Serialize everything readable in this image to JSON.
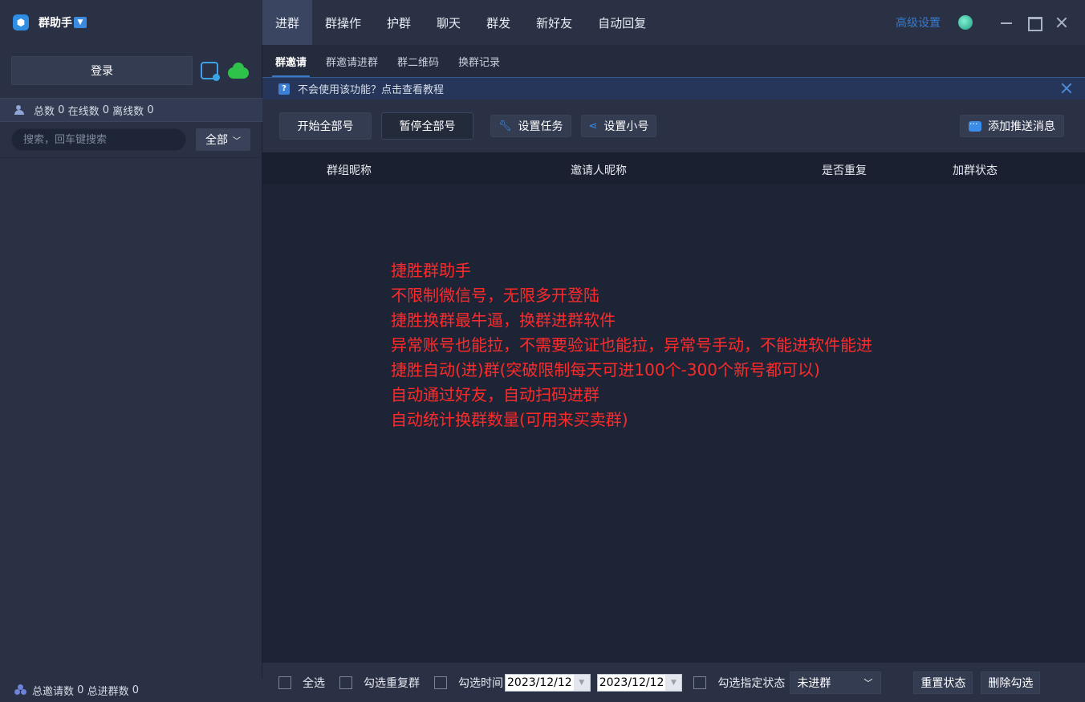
{
  "app": {
    "title": "群助手",
    "logo_glyph": "⬢"
  },
  "sidebar": {
    "login_label": "登录",
    "stats": {
      "total_label": "总数",
      "total_value": "0",
      "online_label": "在线数",
      "online_value": "0",
      "offline_label": "离线数",
      "offline_value": "0"
    },
    "search_placeholder": "搜索，回车键搜索",
    "filter_value": "全部",
    "footer": {
      "invites_label": "总邀请数",
      "invites_value": "0",
      "joined_label": "总进群数",
      "joined_value": "0"
    }
  },
  "topnav": {
    "tabs": [
      {
        "label": "进群",
        "active": true
      },
      {
        "label": "群操作"
      },
      {
        "label": "护群"
      },
      {
        "label": "聊天"
      },
      {
        "label": "群发"
      },
      {
        "label": "新好友"
      },
      {
        "label": "自动回复"
      }
    ],
    "advanced_settings": "高级设置"
  },
  "subtabs": [
    {
      "label": "群邀请",
      "active": true
    },
    {
      "label": "群邀请进群"
    },
    {
      "label": "群二维码"
    },
    {
      "label": "换群记录"
    }
  ],
  "hint": {
    "icon_glyph": "?",
    "text": "不会使用该功能？点击查看教程"
  },
  "toolbar": {
    "start_all": "开始全部号",
    "pause_all": "暂停全部号",
    "set_task": "设置任务",
    "set_alt": "设置小号",
    "add_push": "添加推送消息"
  },
  "table": {
    "columns": [
      "群组昵称",
      "邀请人昵称",
      "是否重复",
      "加群状态"
    ],
    "rows": []
  },
  "overlay_text": [
    "捷胜群助手",
    "不限制微信号，无限多开登陆",
    "捷胜换群最牛逼，换群进群软件",
    "异常账号也能拉，不需要验证也能拉，异常号手动，不能进软件能进",
    "捷胜自动(进)群(突破限制每天可进100个-300个新号都可以)",
    "自动通过好友，自动扫码进群",
    "自动统计换群数量(可用来买卖群)"
  ],
  "bottom": {
    "select_all": "全选",
    "select_dup": "勾选重复群",
    "select_time": "勾选时间",
    "date_from": "2023/12/12",
    "date_to": "2023/12/12",
    "select_status": "勾选指定状态",
    "status_value": "未进群",
    "reset_status": "重置状态",
    "delete_selected": "删除勾选"
  },
  "colors": {
    "accent": "#3a79c8",
    "overlay_red": "#ff2b2b",
    "cloud_green": "#2ec24a"
  }
}
